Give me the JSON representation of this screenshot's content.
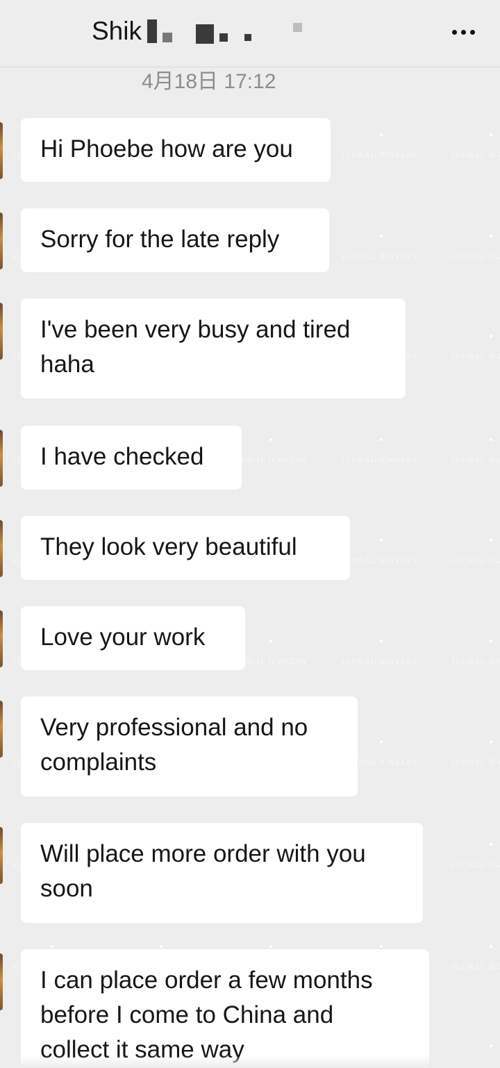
{
  "header": {
    "title": "Shik",
    "menu_icon": "more-horizontal-icon"
  },
  "timestamp": "4月18日 17:12",
  "watermark": {
    "text": "FLORAL JEWELRY"
  },
  "messages": [
    "Hi Phoebe how are you",
    "Sorry for the late reply",
    "I've been very busy and tired\nhaha",
    "I have checked",
    "They look very beautiful",
    "Love your work",
    "Very professional and no\ncomplaints",
    "Will place more order with you\nsoon",
    "I can place order a few months\nbefore I come to China and\ncollect it same way"
  ]
}
